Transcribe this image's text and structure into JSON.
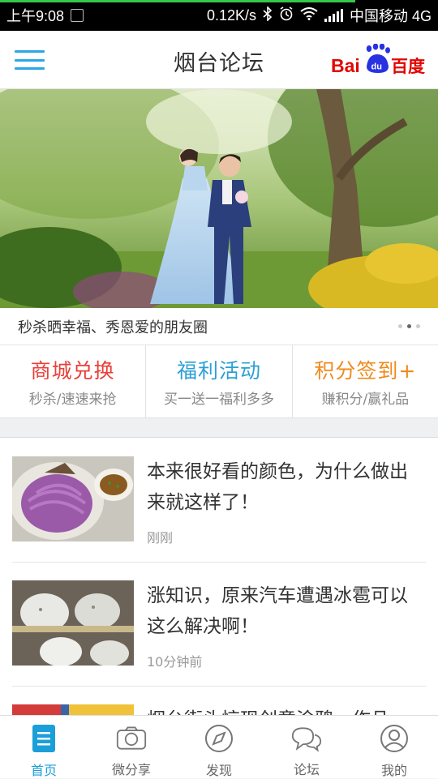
{
  "status_bar": {
    "time": "上午9:08",
    "speed": "0.12K/s",
    "carrier": "中国移动 4G",
    "bluetooth_icon": "bluetooth-icon",
    "alarm_icon": "alarm-icon",
    "wifi_icon": "wifi-icon",
    "signal_icon": "signal-icon"
  },
  "header": {
    "title": "烟台论坛",
    "menu_icon": "hamburger-menu-icon",
    "logo": {
      "bai": "Bai",
      "du": "du",
      "cn": "百度"
    },
    "brand_colors": {
      "blue": "#2932e1",
      "red": "#e10602",
      "accent": "#2aa7e8"
    }
  },
  "banner": {
    "caption": "秒杀晒幸福、秀恩爱的朋友圈",
    "active_slide": 2,
    "slides": 3
  },
  "quick_entries": [
    {
      "title": "商城兑换",
      "subtitle": "秒杀/速速来抢",
      "color": "#e8413a"
    },
    {
      "title": "福利活动",
      "subtitle": "买一送一福利多多",
      "color": "#2a9fd6"
    },
    {
      "title": "积分签到+",
      "subtitle": "赚积分/赢礼品",
      "color": "#f08a1d"
    }
  ],
  "feed": [
    {
      "headline": "本来很好看的颜色，为什么做出来就这样了！",
      "time": "刚刚"
    },
    {
      "headline": "涨知识，原来汽车遭遇冰雹可以这么解决啊！",
      "time": "10分钟前"
    },
    {
      "headline": "烟台街头惊现创意涂鸦，作品",
      "time": ""
    }
  ],
  "bottom_nav": [
    {
      "label": "首页",
      "icon": "home-doc-icon",
      "active": true
    },
    {
      "label": "微分享",
      "icon": "camera-icon",
      "active": false
    },
    {
      "label": "发现",
      "icon": "compass-icon",
      "active": false
    },
    {
      "label": "论坛",
      "icon": "chat-bubbles-icon",
      "active": false
    },
    {
      "label": "我的",
      "icon": "user-icon",
      "active": false
    }
  ]
}
